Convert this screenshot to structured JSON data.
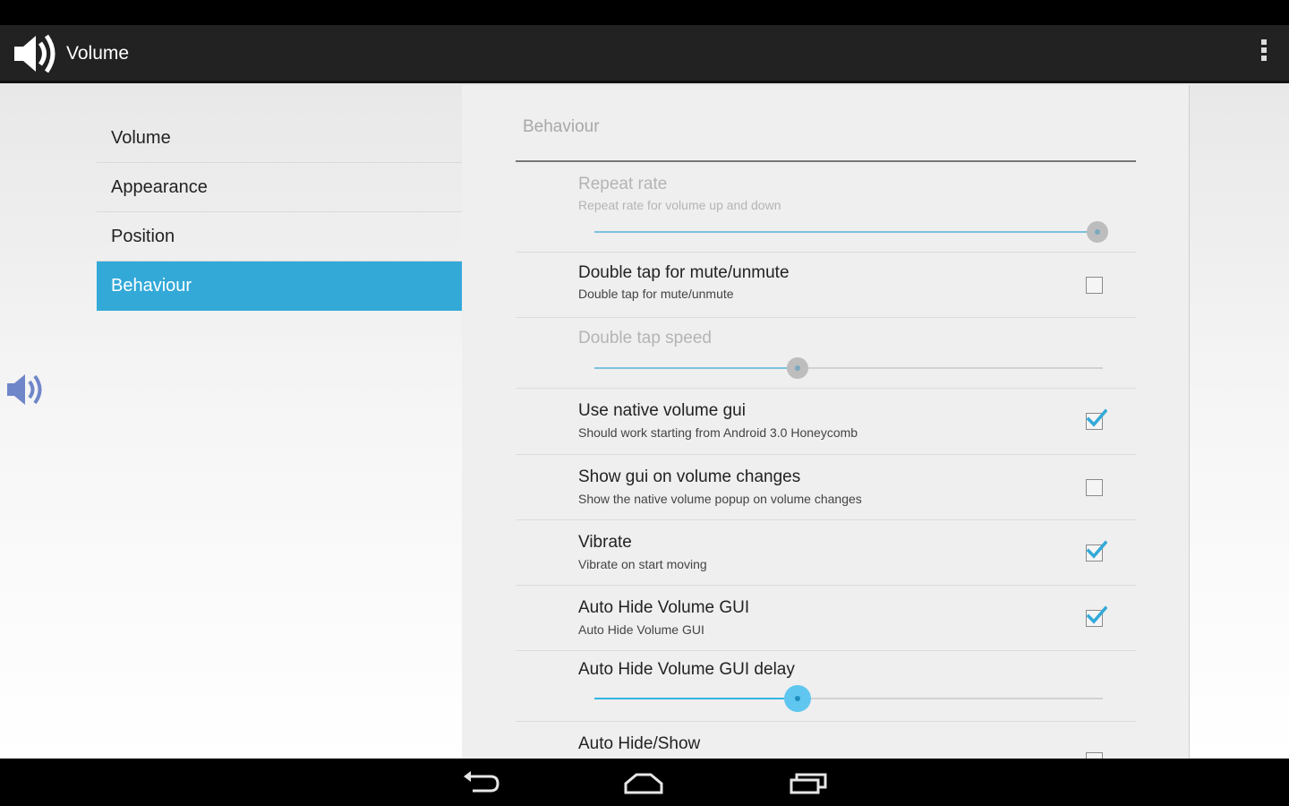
{
  "app": {
    "title": "Volume"
  },
  "icons": {
    "app": "speaker-icon",
    "overflow": "overflow-menu-icon",
    "side": "speaker-icon"
  },
  "colors": {
    "accent": "#33a9d8",
    "action_bar": "#222222"
  },
  "sidebar": {
    "items": [
      {
        "label": "Volume",
        "active": false
      },
      {
        "label": "Appearance",
        "active": false
      },
      {
        "label": "Position",
        "active": false
      },
      {
        "label": "Behaviour",
        "active": true
      }
    ]
  },
  "panel": {
    "category": "Behaviour",
    "prefs": {
      "repeat_rate": {
        "title": "Repeat rate",
        "summary": "Repeat rate for volume up and down",
        "value": 0.99,
        "enabled": false
      },
      "double_tap": {
        "title": "Double tap for mute/unmute",
        "summary": "Double tap for mute/unmute",
        "checked": false
      },
      "double_tap_speed": {
        "title": "Double tap speed",
        "value": 0.4,
        "enabled": false
      },
      "native_gui": {
        "title": "Use native volume gui",
        "summary": "Should work starting from Android 3.0 Honeycomb",
        "checked": true
      },
      "show_gui": {
        "title": "Show gui on volume changes",
        "summary": "Show the native volume popup on volume changes",
        "checked": false
      },
      "vibrate": {
        "title": "Vibrate",
        "summary": "Vibrate on start moving",
        "checked": true
      },
      "auto_hide": {
        "title": "Auto Hide Volume GUI",
        "summary": "Auto Hide Volume GUI",
        "checked": true
      },
      "auto_hide_delay": {
        "title": "Auto Hide Volume GUI delay",
        "value": 0.4,
        "enabled": true
      },
      "auto_hide_show": {
        "title": "Auto Hide/Show",
        "checked": false
      }
    }
  },
  "navbar": {
    "back": "back-icon",
    "home": "home-icon",
    "recents": "recents-icon"
  }
}
